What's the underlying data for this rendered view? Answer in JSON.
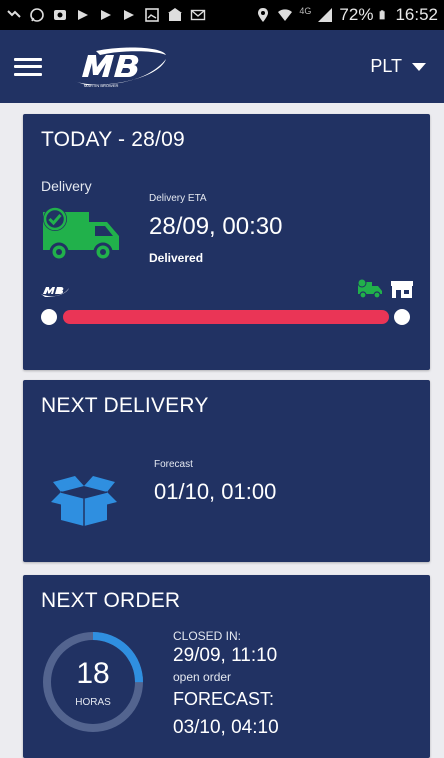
{
  "status_bar": {
    "network": "4G",
    "battery": "72%",
    "time": "16:52"
  },
  "app_bar": {
    "logo_text": "MB",
    "logo_subtext": "MARTIN BROWER",
    "plant": "PLT",
    "menu_icon": "hamburger-menu-icon"
  },
  "today": {
    "title": "TODAY - 28/09",
    "delivery_label": "Delivery",
    "eta_label": "Delivery ETA",
    "eta_value": "28/09, 00:30",
    "status": "Delivered",
    "progress_fraction": 1.0,
    "colors": {
      "accent_green": "#21b14b",
      "progress_red": "#ea3556"
    }
  },
  "next_delivery": {
    "title": "NEXT DELIVERY",
    "forecast_label": "Forecast",
    "forecast_value": "01/10, 01:00",
    "icon": "open-box-icon",
    "icon_color": "#2f8fe0"
  },
  "next_order": {
    "title": "NEXT ORDER",
    "hours": "18",
    "hours_unit": "HORAS",
    "gauge_fraction": 0.25,
    "closed_in_label": "CLOSED IN:",
    "closed_in_value": "29/09, 11:10",
    "order_status": "open order",
    "forecast_label": "FORECAST:",
    "forecast_value": "03/10, 04:10",
    "colors": {
      "gauge_fill": "#2f8fe0",
      "gauge_track": "#53648f"
    }
  }
}
